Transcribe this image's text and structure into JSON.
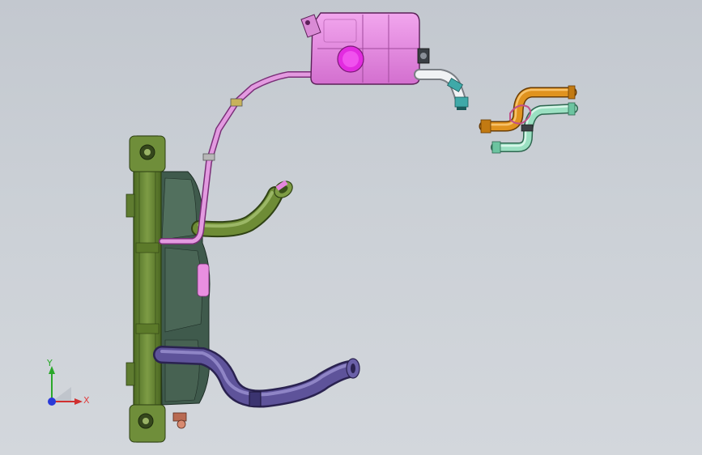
{
  "viewport": {
    "background_top": "#c3c8cf",
    "background_bottom": "#d3d7dc"
  },
  "colors": {
    "radiator": "#6c8a3a",
    "radiator_dark": "#3f5a1f",
    "fan_shroud": "#3e5a4a",
    "reservoir": "#e67fe0",
    "reservoir_cap": "#e22be0",
    "pink_hose": "#d98ad8",
    "upper_hose": "#5c7a2a",
    "lower_hose": "#5a4f8e",
    "orange_pipe": "#d98a1c",
    "mint_pipe": "#8fd6b8",
    "teal_fitting": "#3fa9a8"
  },
  "triad": {
    "x_label": "X",
    "y_label": "Y"
  }
}
